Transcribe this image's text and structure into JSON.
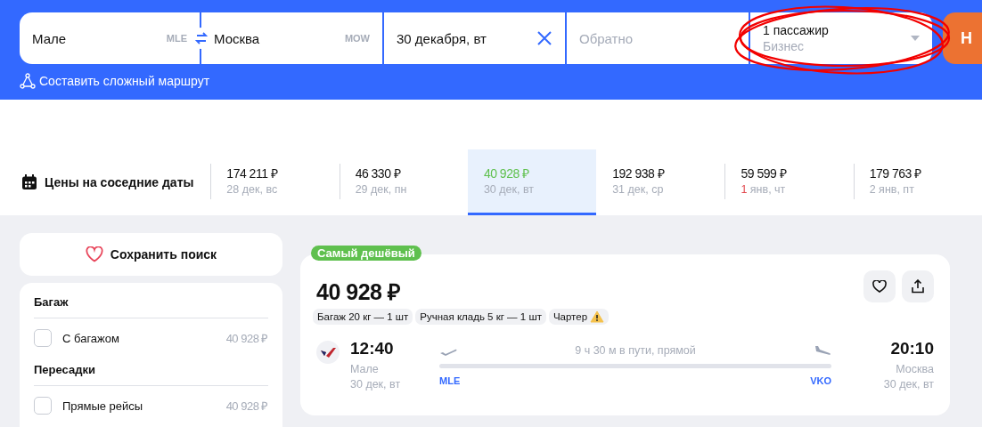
{
  "search": {
    "origin": {
      "value": "Мале",
      "code": "MLE"
    },
    "destination": {
      "value": "Москва",
      "code": "MOW"
    },
    "depart_date": {
      "value": "30 декабря, вт"
    },
    "return_date": {
      "placeholder": "Обратно"
    },
    "passengers": {
      "count": "1 пассажир",
      "cabin": "Бизнес"
    },
    "search_button": {
      "label": "Н"
    },
    "complex_route_link": "Составить сложный маршрут"
  },
  "nearby_dates": {
    "title": "Цены на соседние даты",
    "items": [
      {
        "price": "174 211 ₽",
        "day": "28",
        "rest": "дек, вс",
        "holiday": false,
        "cheapest": false,
        "selected": false
      },
      {
        "price": "46 330 ₽",
        "day": "29",
        "rest": "дек, пн",
        "holiday": false,
        "cheapest": false,
        "selected": false
      },
      {
        "price": "40 928 ₽",
        "day": "30",
        "rest": "дек, вт",
        "holiday": false,
        "cheapest": true,
        "selected": true
      },
      {
        "price": "192 938 ₽",
        "day": "31",
        "rest": "дек, ср",
        "holiday": false,
        "cheapest": false,
        "selected": false
      },
      {
        "price": "59 599 ₽",
        "day": "1",
        "rest": "янв, чт",
        "holiday": true,
        "cheapest": false,
        "selected": false
      },
      {
        "price": "179 763 ₽",
        "day": "2",
        "rest": "янв, пт",
        "holiday": false,
        "cheapest": false,
        "selected": false
      }
    ]
  },
  "sidebar": {
    "save_search": "Сохранить поиск",
    "filters": [
      {
        "title": "Багаж",
        "options": [
          {
            "label": "С багажом",
            "price": "40 928 ₽",
            "checked": false
          }
        ]
      },
      {
        "title": "Пересадки",
        "options": [
          {
            "label": "Прямые рейсы",
            "price": "40 928 ₽",
            "checked": false
          }
        ]
      }
    ]
  },
  "ticket": {
    "badge": "Самый дешёвый",
    "price": "40 928 ₽",
    "tags": [
      {
        "text": "Багаж 20 кг — 1 шт",
        "warning": false
      },
      {
        "text": "Ручная кладь 5 кг — 1 шт",
        "warning": false
      },
      {
        "text": "Чартер",
        "warning": true
      }
    ],
    "departure": {
      "time": "12:40",
      "city": "Мале",
      "date": "30 дек, вт",
      "code": "MLE"
    },
    "duration": "9 ч 30 м в пути, прямой",
    "arrival": {
      "time": "20:10",
      "city": "Москва",
      "date": "30 дек, вт",
      "code": "VKO"
    }
  }
}
